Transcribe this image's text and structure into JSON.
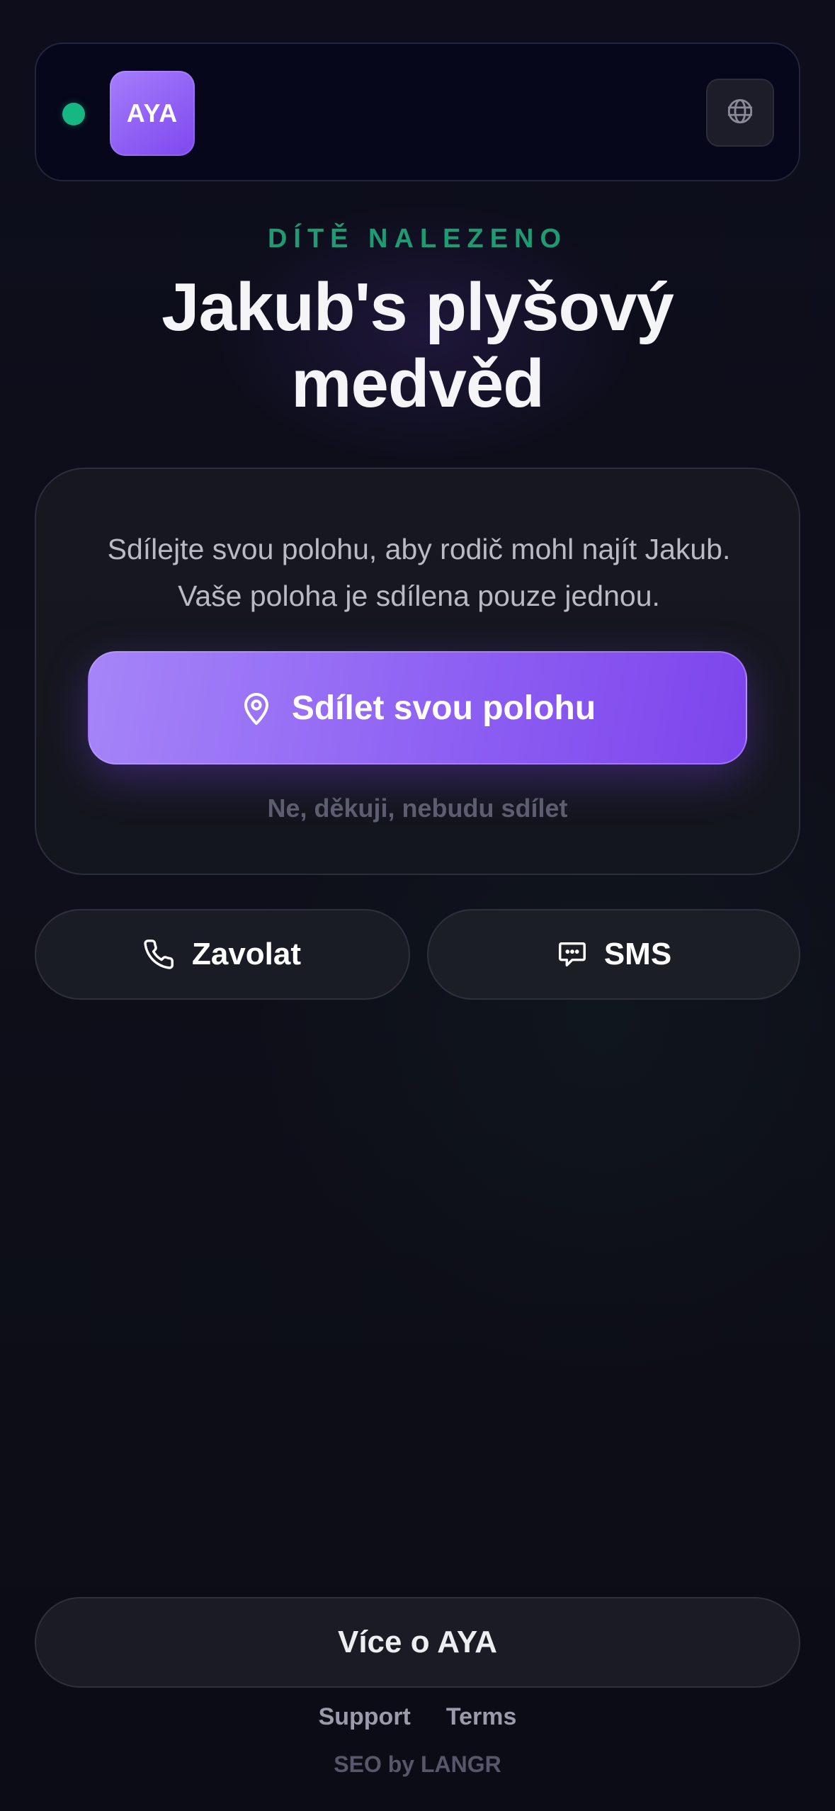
{
  "header": {
    "status": "online",
    "logo_text": "AYA",
    "language_icon": "globe-icon"
  },
  "hero": {
    "eyebrow": "DÍTĚ NALEZENO",
    "title": "Jakub's plyšový medvěd"
  },
  "share_card": {
    "message": "Sdílejte svou polohu, aby rodič mohl najít Jakub. Vaše poloha je sdílena pouze jednou.",
    "share_button_label": "Sdílet svou polohu",
    "share_button_icon": "location-pin-icon",
    "decline_label": "Ne, děkuji, nebudu sdílet"
  },
  "contact": {
    "call_label": "Zavolat",
    "call_icon": "phone-icon",
    "sms_label": "SMS",
    "sms_icon": "chat-bubble-icon"
  },
  "footer": {
    "more_label": "Více o AYA",
    "links": [
      "Support",
      "Terms"
    ],
    "credit": "SEO by LANGR"
  },
  "colors": {
    "accent": "#8e60f3",
    "success": "#17b783",
    "background": "#0d0e1a"
  }
}
